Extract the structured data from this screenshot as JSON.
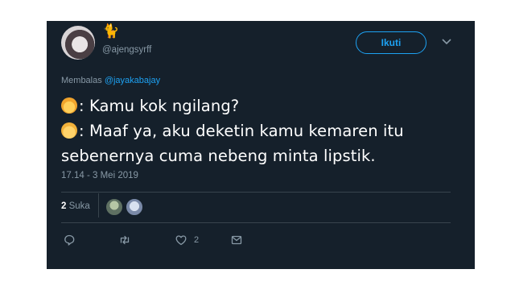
{
  "tweet": {
    "name_emoji": "🐈",
    "handle": "@ajengsyrff",
    "follow_label": "Ikuti",
    "reply_prefix": "Membalas",
    "reply_to": "@jayakabajay",
    "line1": ": Kamu kok ngilang?",
    "line2": ": Maaf ya, aku deketin kamu kemaren itu",
    "line3": "sebenernya cuma nebeng minta lipstik.",
    "timestamp": "17.14 - 3 Mei 2019",
    "likes_count": "2",
    "likes_label": "Suka",
    "like_action_count": "2"
  },
  "icons": {
    "reply": "comment-icon",
    "retweet": "retweet-icon",
    "like": "heart-icon",
    "dm": "envelope-icon",
    "menu": "chevron-down-icon"
  },
  "colors": {
    "card_bg": "#15202b",
    "accent": "#1da1f2",
    "muted": "#8899a6",
    "divider": "#38444d"
  }
}
